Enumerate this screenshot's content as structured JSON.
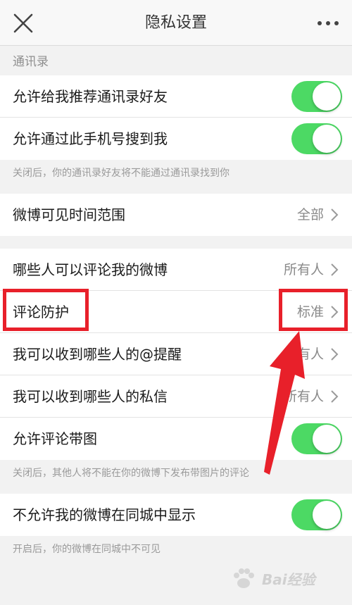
{
  "header": {
    "title": "隐私设置"
  },
  "sections": {
    "contacts_header": "通讯录",
    "contacts_note": "关闭后，你的通讯录好友将不能通过通讯录找到你",
    "image_comment_note": "关闭后，其他人将不能在你的微博下发布带图片的评论",
    "city_note": "开启后，你的微博在同城中不可见"
  },
  "rows": [
    {
      "label": "允许给我推荐通讯录好友",
      "toggle": true
    },
    {
      "label": "允许通过此手机号搜到我",
      "toggle": true
    },
    {
      "label": "微博可见时间范围",
      "value": "全部"
    },
    {
      "label": "哪些人可以评论我的微博",
      "value": "所有人"
    },
    {
      "label": "评论防护",
      "value": "标准"
    },
    {
      "label": "我可以收到哪些人的@提醒",
      "value": "所有人"
    },
    {
      "label": "我可以收到哪些人的私信",
      "value": "所有人"
    },
    {
      "label": "允许评论带图",
      "toggle": true
    },
    {
      "label": "不允许我的微博在同城中显示",
      "toggle": true
    }
  ],
  "watermark": {
    "text": "Bai经验"
  },
  "colors": {
    "toggle_on": "#4cd964",
    "annotation": "#e8202a",
    "background": "#f2f2f2"
  },
  "icons": {
    "close": "close-icon",
    "more": "more-icon",
    "chevron": "chevron-right-icon"
  }
}
